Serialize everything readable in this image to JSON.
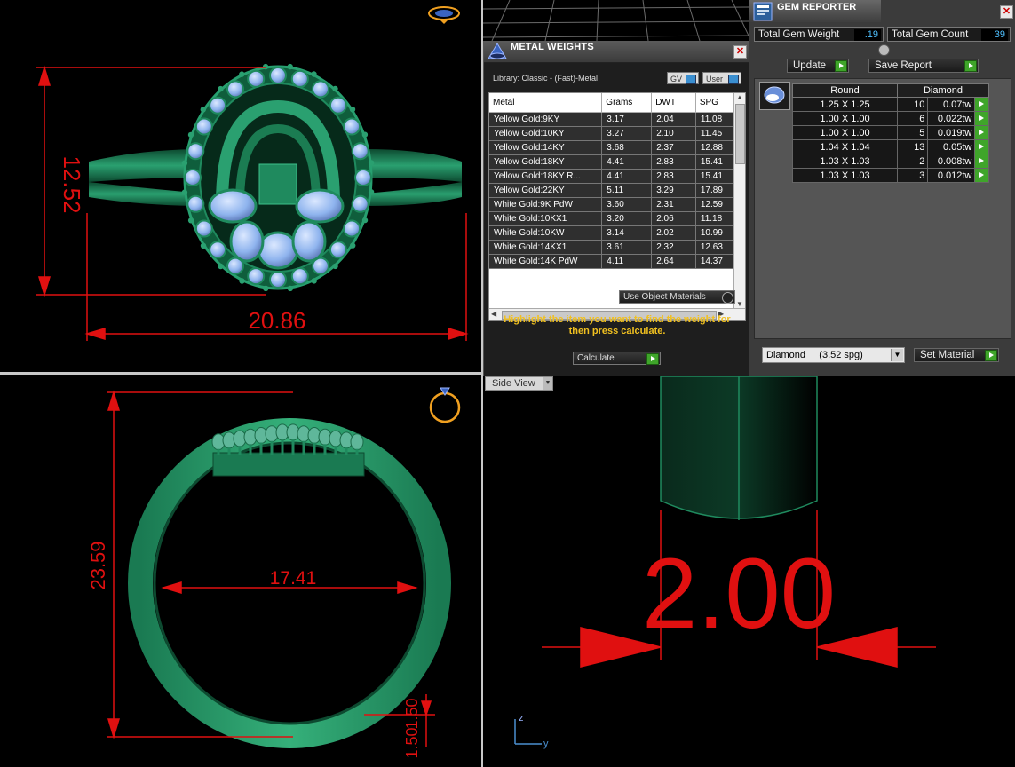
{
  "viewports": {
    "top_view": {
      "dim_height": "12.52",
      "dim_width": "20.86"
    },
    "front_view": {
      "dim_height": "23.59",
      "dim_inner": "17.41",
      "dim_band_1": "1.50",
      "dim_band_2": "1.50"
    },
    "side_view": {
      "label": "Side View",
      "dim_width": "2.00",
      "axis_z": "z",
      "axis_y": "y"
    }
  },
  "metal_weights": {
    "title": "METAL WEIGHTS",
    "library": "Library: Classic - (Fast)-Metal",
    "toggle_gv": "GV",
    "toggle_user": "User",
    "columns": [
      "Metal",
      "Grams",
      "DWT",
      "SPG"
    ],
    "rows": [
      [
        "Yellow Gold:9KY",
        "3.17",
        "2.04",
        "11.08"
      ],
      [
        "Yellow Gold:10KY",
        "3.27",
        "2.10",
        "11.45"
      ],
      [
        "Yellow Gold:14KY",
        "3.68",
        "2.37",
        "12.88"
      ],
      [
        "Yellow Gold:18KY",
        "4.41",
        "2.83",
        "15.41"
      ],
      [
        "Yellow Gold:18KY R...",
        "4.41",
        "2.83",
        "15.41"
      ],
      [
        "Yellow Gold:22KY",
        "5.11",
        "3.29",
        "17.89"
      ],
      [
        "White Gold:9K PdW",
        "3.60",
        "2.31",
        "12.59"
      ],
      [
        "White Gold:10KX1",
        "3.20",
        "2.06",
        "11.18"
      ],
      [
        "White Gold:10KW",
        "3.14",
        "2.02",
        "10.99"
      ],
      [
        "White Gold:14KX1",
        "3.61",
        "2.32",
        "12.63"
      ],
      [
        "White Gold:14K PdW",
        "4.11",
        "2.64",
        "14.37"
      ]
    ],
    "use_object_materials": "Use Object Materials",
    "message": "Highlight the item you want to find the weight for then press calculate.",
    "calculate_label": "Calculate"
  },
  "gem_reporter": {
    "title": "GEM REPORTER",
    "total_weight_label": "Total Gem Weight",
    "total_weight_value": ".19",
    "total_count_label": "Total Gem Count",
    "total_count_value": "39",
    "update_label": "Update",
    "save_report_label": "Save Report",
    "columns": [
      "Round",
      "Diamond"
    ],
    "gems": [
      {
        "size": "1.25 X 1.25",
        "count": "10",
        "weight": "0.07tw"
      },
      {
        "size": "1.00 X 1.00",
        "count": "6",
        "weight": "0.022tw"
      },
      {
        "size": "1.00 X 1.00",
        "count": "5",
        "weight": "0.019tw"
      },
      {
        "size": "1.04 X 1.04",
        "count": "13",
        "weight": "0.05tw"
      },
      {
        "size": "1.03 X 1.03",
        "count": "2",
        "weight": "0.008tw"
      },
      {
        "size": "1.03 X 1.03",
        "count": "3",
        "weight": "0.012tw"
      }
    ],
    "material_select": "Diamond     (3.52 spg)",
    "set_material_label": "Set Material"
  },
  "colors": {
    "ring_green": "#1f8a5e",
    "gem_blue": "#8fb4ee",
    "dimension_red": "#e01010",
    "accent_orange": "#f0a020",
    "message_yellow": "#f0c020"
  }
}
